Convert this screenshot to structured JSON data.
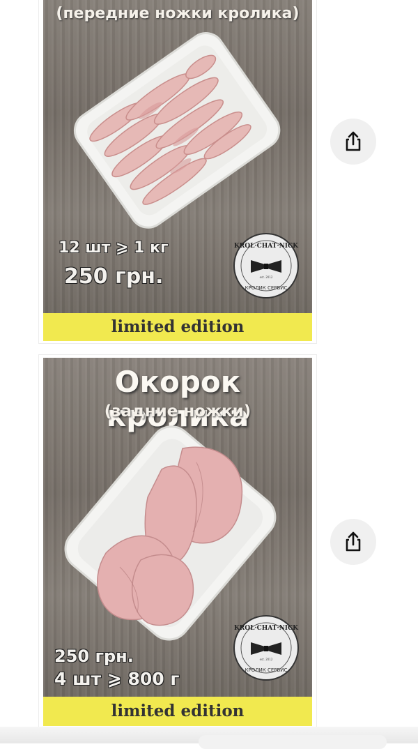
{
  "cards": [
    {
      "subtitle": "(передние ножки кролика)",
      "price_line1": "12 шт ⩾ 1 кг",
      "price_line2": "250 грн.",
      "badge": "limited edition",
      "logo": {
        "top": "KROL · CHAT · NICK",
        "est": "est. 2012",
        "bottom": "КРОЛИК СЕРВИС"
      }
    },
    {
      "title": "Окорок кролика",
      "subtitle": "(задние ножки)",
      "price_line1": "250 грн.",
      "price_line2": "4 шт ⩾ 800 г",
      "badge": "limited edition",
      "logo": {
        "top": "KROL · CHAT · NICK",
        "est": "est. 2012",
        "bottom": "КРОЛИК СЕРВИС"
      }
    }
  ],
  "share": {
    "icon": "share-icon"
  }
}
